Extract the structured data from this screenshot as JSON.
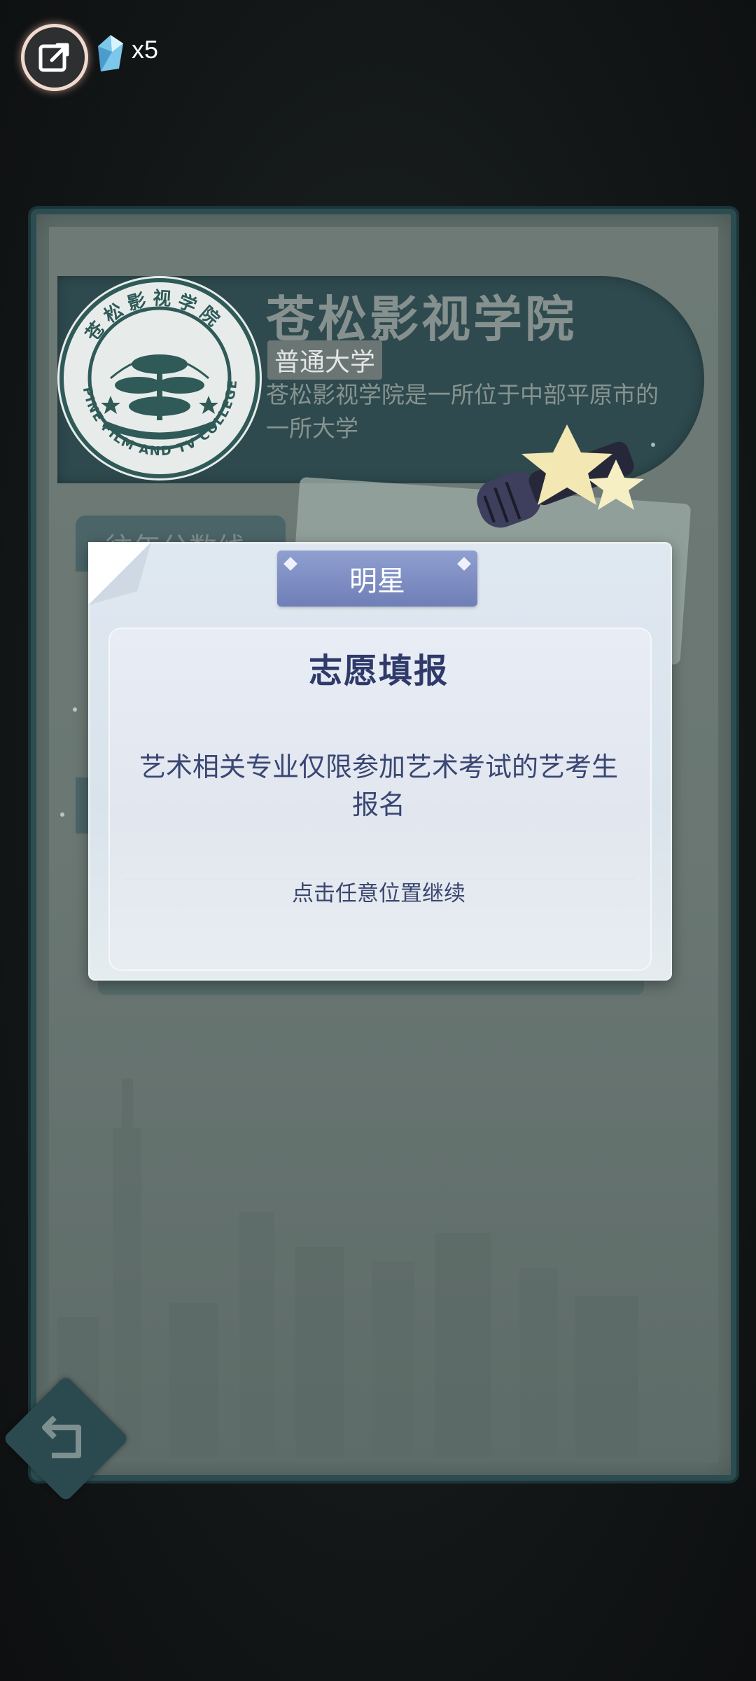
{
  "hud": {
    "exit_icon": "exit-arrow-icon",
    "currency_icon": "blue-crystal-icon",
    "currency_count": "x5"
  },
  "school": {
    "name": "苍松影视学院",
    "type": "普通大学",
    "description": "苍松影视学院是一所位于中部平原市的一所大学",
    "logo_text_cn": "苍松影视学院",
    "logo_text_en": "PINE FILM AND TV COLLEGE"
  },
  "background_tab": {
    "label": "往年分数线"
  },
  "dialog": {
    "ribbon_label": "明星",
    "title": "志愿填报",
    "message": "艺术相关专业仅限参加艺术考试的艺考生报名",
    "hint": "点击任意位置继续"
  },
  "footer": {
    "back_icon": "back-arrow-icon"
  },
  "colors": {
    "panel_border": "#2b4d52",
    "ribbon": "#7b8bc2",
    "title_text": "#2f3a6b"
  }
}
